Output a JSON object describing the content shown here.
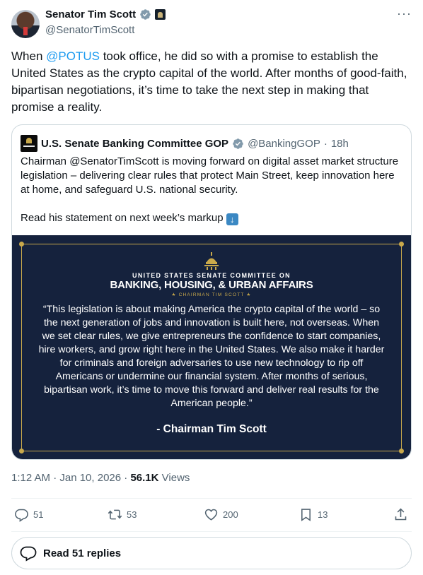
{
  "author": {
    "display_name": "Senator Tim Scott",
    "handle": "@SenatorTimScott"
  },
  "tweet": {
    "text_before": "When ",
    "mention": "@POTUS",
    "text_after": " took office, he did so with a promise to establish the United States as the crypto capital of the world. After months of good-faith, bipartisan negotiations, it’s time to take the next step in making that promise a reality."
  },
  "quoted": {
    "display_name": "U.S. Senate Banking Committee GOP",
    "handle": "@BankingGOP",
    "separator": "·",
    "time": "18h",
    "text_p1": "Chairman @SenatorTimScott is moving forward on digital asset market structure legislation – delivering clear rules that protect Main Street, keep innovation here at home, and safeguard U.S. national security.",
    "text_p2": "Read his statement on next week’s markup",
    "image": {
      "org_line1": "UNITED STATES SENATE COMMITTEE ON",
      "org_line2": "BANKING, HOUSING, & URBAN AFFAIRS",
      "org_line3": "★ CHAIRMAN TIM SCOTT ★",
      "quote": "“This legislation is about making America the crypto capital of the world – so the next generation of jobs and innovation is built here, not overseas. When we set clear rules, we give entrepreneurs the confidence to start companies, hire workers, and grow right here in the United States. We also make it harder for criminals and foreign adversaries to use new technology to rip off Americans or undermine our financial system. After months of serious, bipartisan work, it’s time to move this forward and deliver real results for the American people.”",
      "attribution": "- Chairman Tim Scott"
    }
  },
  "meta": {
    "timestamp": "1:12 AM · Jan 10, 2026",
    "separator": "·",
    "views_count": "56.1K",
    "views_label": "Views"
  },
  "actions": {
    "replies": "51",
    "reposts": "53",
    "likes": "200",
    "bookmarks": "13"
  },
  "read_replies_label": "Read 51 replies",
  "colors": {
    "accent": "#1d9bf0",
    "image_bg": "#15223d",
    "gold": "#c9a94b"
  }
}
